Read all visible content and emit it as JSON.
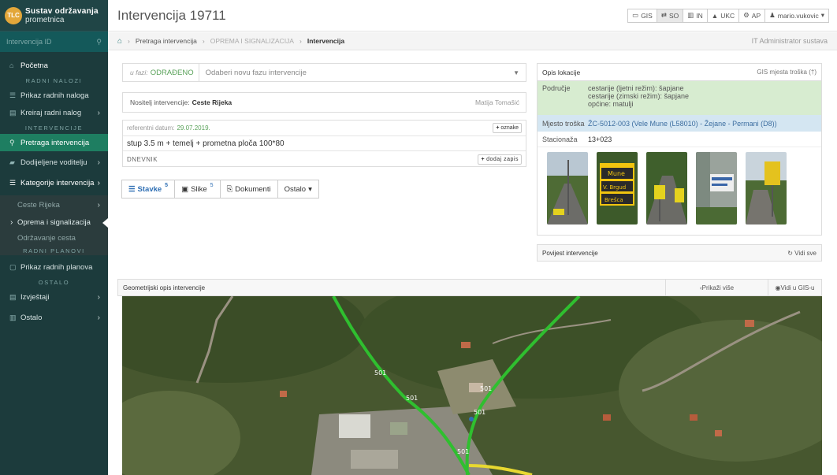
{
  "brand": {
    "line1": "Sustav održavanja",
    "line2": "prometnica",
    "logo_text": "TLC"
  },
  "sidebar": {
    "search_placeholder": "Intervencija ID",
    "items": [
      {
        "label": "Početna",
        "icon": "home-icon"
      },
      {
        "label": "RADNI NALOZI",
        "type": "heading"
      },
      {
        "label": "Prikaz radnih naloga",
        "icon": "list-icon"
      },
      {
        "label": "Kreiraj radni nalog",
        "icon": "table-icon"
      },
      {
        "label": "INTERVENCIJE",
        "type": "heading"
      },
      {
        "label": "Pretraga intervencija",
        "icon": "search-icon"
      },
      {
        "label": "Dodijeljene voditelju",
        "icon": "car-icon"
      },
      {
        "label": "Kategorije intervencija",
        "icon": "list-icon"
      },
      {
        "label": "Ceste Rijeka"
      },
      {
        "label": "Oprema i signalizacija"
      },
      {
        "label": "Održavanje cesta"
      },
      {
        "label": "RADNI PLANOVI",
        "type": "heading"
      },
      {
        "label": "Prikaz radnih planova",
        "icon": "calendar-icon"
      },
      {
        "label": "OSTALO",
        "type": "heading"
      },
      {
        "label": "Izvještaji",
        "icon": "report-icon"
      },
      {
        "label": "Ostalo",
        "icon": "chart-icon"
      }
    ]
  },
  "header": {
    "title": "Intervencija 19711",
    "nav": [
      {
        "label": "GIS",
        "icon": "map-icon"
      },
      {
        "label": "SO",
        "icon": "swap-icon"
      },
      {
        "label": "IN",
        "icon": "chart-icon"
      },
      {
        "label": "UKC",
        "icon": "road-icon"
      },
      {
        "label": "AP",
        "icon": "gear-icon"
      },
      {
        "label": "mario.vukovic",
        "icon": "user-icon"
      }
    ]
  },
  "breadcrumb": {
    "items": [
      "Pretraga intervencija",
      "OPREMA I SIGNALIZACIJA",
      "Intervencija"
    ],
    "role": "IT Administrator sustava"
  },
  "phase": {
    "label": "u fazi:",
    "value": "ODRAĐENO",
    "placeholder": "Odaberi novu fazu intervencije"
  },
  "nositelj": {
    "label": "Nositelj intervencije:",
    "value": "Ceste Rijeka",
    "user": "Matija Tomašić"
  },
  "reference": {
    "label": "referentni datum:",
    "date": "29.07.2019.",
    "tags_button": "oznake",
    "description": "stup 3.5 m + temelj + prometna ploča 100*80",
    "log_label": "DNEVNIK",
    "add_button": "dodaj zapis"
  },
  "tabs": [
    {
      "label": "Stavke",
      "count": "5",
      "icon": "list-icon"
    },
    {
      "label": "Slike",
      "count": "5",
      "icon": "image-icon"
    },
    {
      "label": "Dokumenti",
      "icon": "document-icon"
    },
    {
      "label": "Ostalo",
      "icon": "caret-icon"
    }
  ],
  "location": {
    "title": "Opis lokacije",
    "gis_link": "GIS mjesta troška (†)",
    "area_label": "Područje",
    "area_lines": [
      "cestarije (ljetni režim): šapjane",
      "cestarije (zimski režim): šapjane",
      "općine: matulji"
    ],
    "cost_label": "Mjesto troška",
    "cost_value": "ŽC-5012-003 (Vele Mune (L58010) - Žejane - Permani (D8))",
    "station_label": "Stacionaža",
    "station_value": "13+023",
    "sign_texts": [
      "Mune",
      "V. Brgud",
      "Brešca"
    ]
  },
  "history": {
    "title": "Povijest intervencije",
    "button": "Vidi sve"
  },
  "geo": {
    "title": "Geometrijski opis intervencije",
    "more": "Prikaži više",
    "gis": "Vidi u GIS-u"
  },
  "map": {
    "road_labels": [
      "501",
      "501",
      "501",
      "501",
      "501"
    ]
  },
  "colors": {
    "sidebar": "#1c3b3c",
    "active": "#1e7e61",
    "road_green": "#2fbf2f",
    "road_yellow": "#e8d830"
  }
}
